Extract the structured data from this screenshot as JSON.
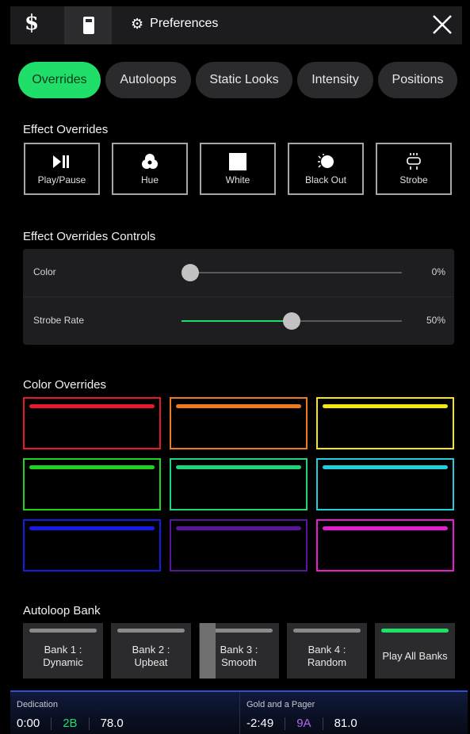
{
  "topbar": {
    "logo_text": "$",
    "preferences_label": "Preferences",
    "icons": [
      "logo-icon",
      "usb-icon",
      "gear-icon",
      "close-icon"
    ]
  },
  "tabs": [
    {
      "label": "Overrides",
      "active": true
    },
    {
      "label": "Autoloops",
      "active": false
    },
    {
      "label": "Static Looks",
      "active": false
    },
    {
      "label": "Intensity",
      "active": false
    },
    {
      "label": "Positions",
      "active": false
    }
  ],
  "effect_overrides": {
    "title": "Effect Overrides",
    "buttons": [
      {
        "label": "Play/Pause",
        "icon": "play-pause-icon"
      },
      {
        "label": "Hue",
        "icon": "hue-icon"
      },
      {
        "label": "White",
        "icon": "white-icon"
      },
      {
        "label": "Black Out",
        "icon": "black-out-icon"
      },
      {
        "label": "Strobe",
        "icon": "strobe-icon"
      }
    ]
  },
  "controls": {
    "title": "Effect Overrides Controls",
    "rows": [
      {
        "label": "Color",
        "value": "0%",
        "level": 0.0
      },
      {
        "label": "Strobe Rate",
        "value": "50%",
        "level": 0.5
      }
    ],
    "accent": "#1fde6a"
  },
  "color_overrides": {
    "title": "Color Overrides",
    "colors": [
      "#e8192c",
      "#f07a1e",
      "#f5e614",
      "#1fd41f",
      "#1ed67a",
      "#1ecfdc",
      "#1a1ae8",
      "#5a14a0",
      "#e81ad2"
    ]
  },
  "autoloop_bank": {
    "title": "Autoloop Bank",
    "banks": [
      {
        "label": "Bank 1 :\nDynamic",
        "active": false
      },
      {
        "label": "Bank 2 :\nUpbeat",
        "active": false
      },
      {
        "label": "Bank 3 :\nSmooth",
        "active": false
      },
      {
        "label": "Bank 4 :\nRandom",
        "active": false
      },
      {
        "label": "Play All Banks",
        "active": true
      }
    ]
  },
  "player": {
    "left": {
      "title": "Dedication",
      "time": "0:00",
      "key": "2B",
      "bpm": "78.0",
      "key_color": "#1fde6a"
    },
    "right": {
      "title": "Gold and a Pager",
      "time": "-2:49",
      "key": "9A",
      "bpm": "81.0",
      "key_color": "#b06ae8"
    }
  }
}
